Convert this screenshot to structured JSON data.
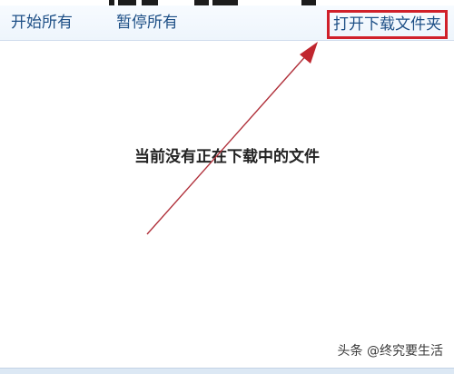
{
  "toolbar": {
    "start_all_label": "开始所有",
    "pause_all_label": "暂停所有",
    "open_folder_label": "打开下载文件夹"
  },
  "main": {
    "empty_message": "当前没有正在下载中的文件"
  },
  "watermark": {
    "text": "头条 @终究要生活"
  },
  "colors": {
    "link": "#1d4f86",
    "highlight_box": "#d0202a",
    "arrow": "#b0303a"
  },
  "icons": {
    "annotation": "arrow-icon"
  }
}
